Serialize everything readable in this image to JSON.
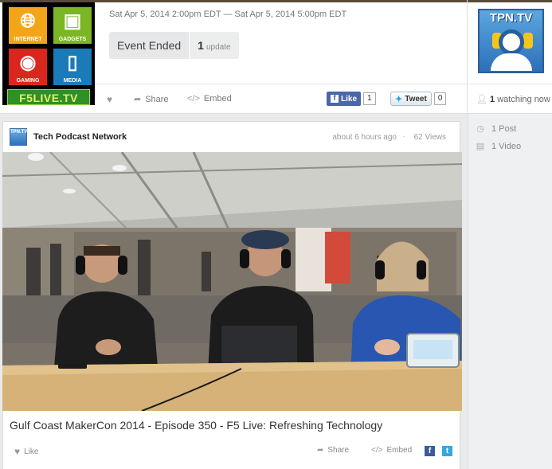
{
  "brand_logo": {
    "tiles": [
      {
        "label": "INTERNET",
        "icon": "globe-icon"
      },
      {
        "label": "GADGETS",
        "icon": "gadget-icon"
      },
      {
        "label": "GAMING",
        "icon": "gamepad-icon"
      },
      {
        "label": "MEDIA",
        "icon": "tablet-icon"
      }
    ],
    "footer": "F5LIVE.TV"
  },
  "event": {
    "date_range": "Sat Apr 5, 2014 2:00pm EDT — Sat Apr 5, 2014 5:00pm EDT",
    "status": "Event Ended",
    "update_count": "1",
    "update_label": "update"
  },
  "channel_logo": {
    "text": "TPN.TV"
  },
  "action_bar": {
    "share_label": "Share",
    "embed_label": "Embed",
    "fb_like_label": "Like",
    "fb_like_count": "1",
    "tweet_label": "Tweet",
    "tweet_count": "0",
    "watching_count": "1",
    "watching_label": "watching now"
  },
  "sidebar": {
    "posts_label": "1 Post",
    "videos_label": "1 Video"
  },
  "post": {
    "author": "Tech Podcast Network",
    "author_avatar_text": "TPN.TV",
    "time": "about 6 hours ago",
    "views": "62 Views",
    "title": "Gulf Coast MakerCon 2014 - Episode 350 - F5 Live: Refreshing Technology",
    "like_label": "Like",
    "share_label": "Share",
    "embed_label": "Embed"
  },
  "colors": {
    "facebook": "#3b5b9a",
    "twitter": "#35a8e0",
    "logo_green": "#2f8f28"
  }
}
